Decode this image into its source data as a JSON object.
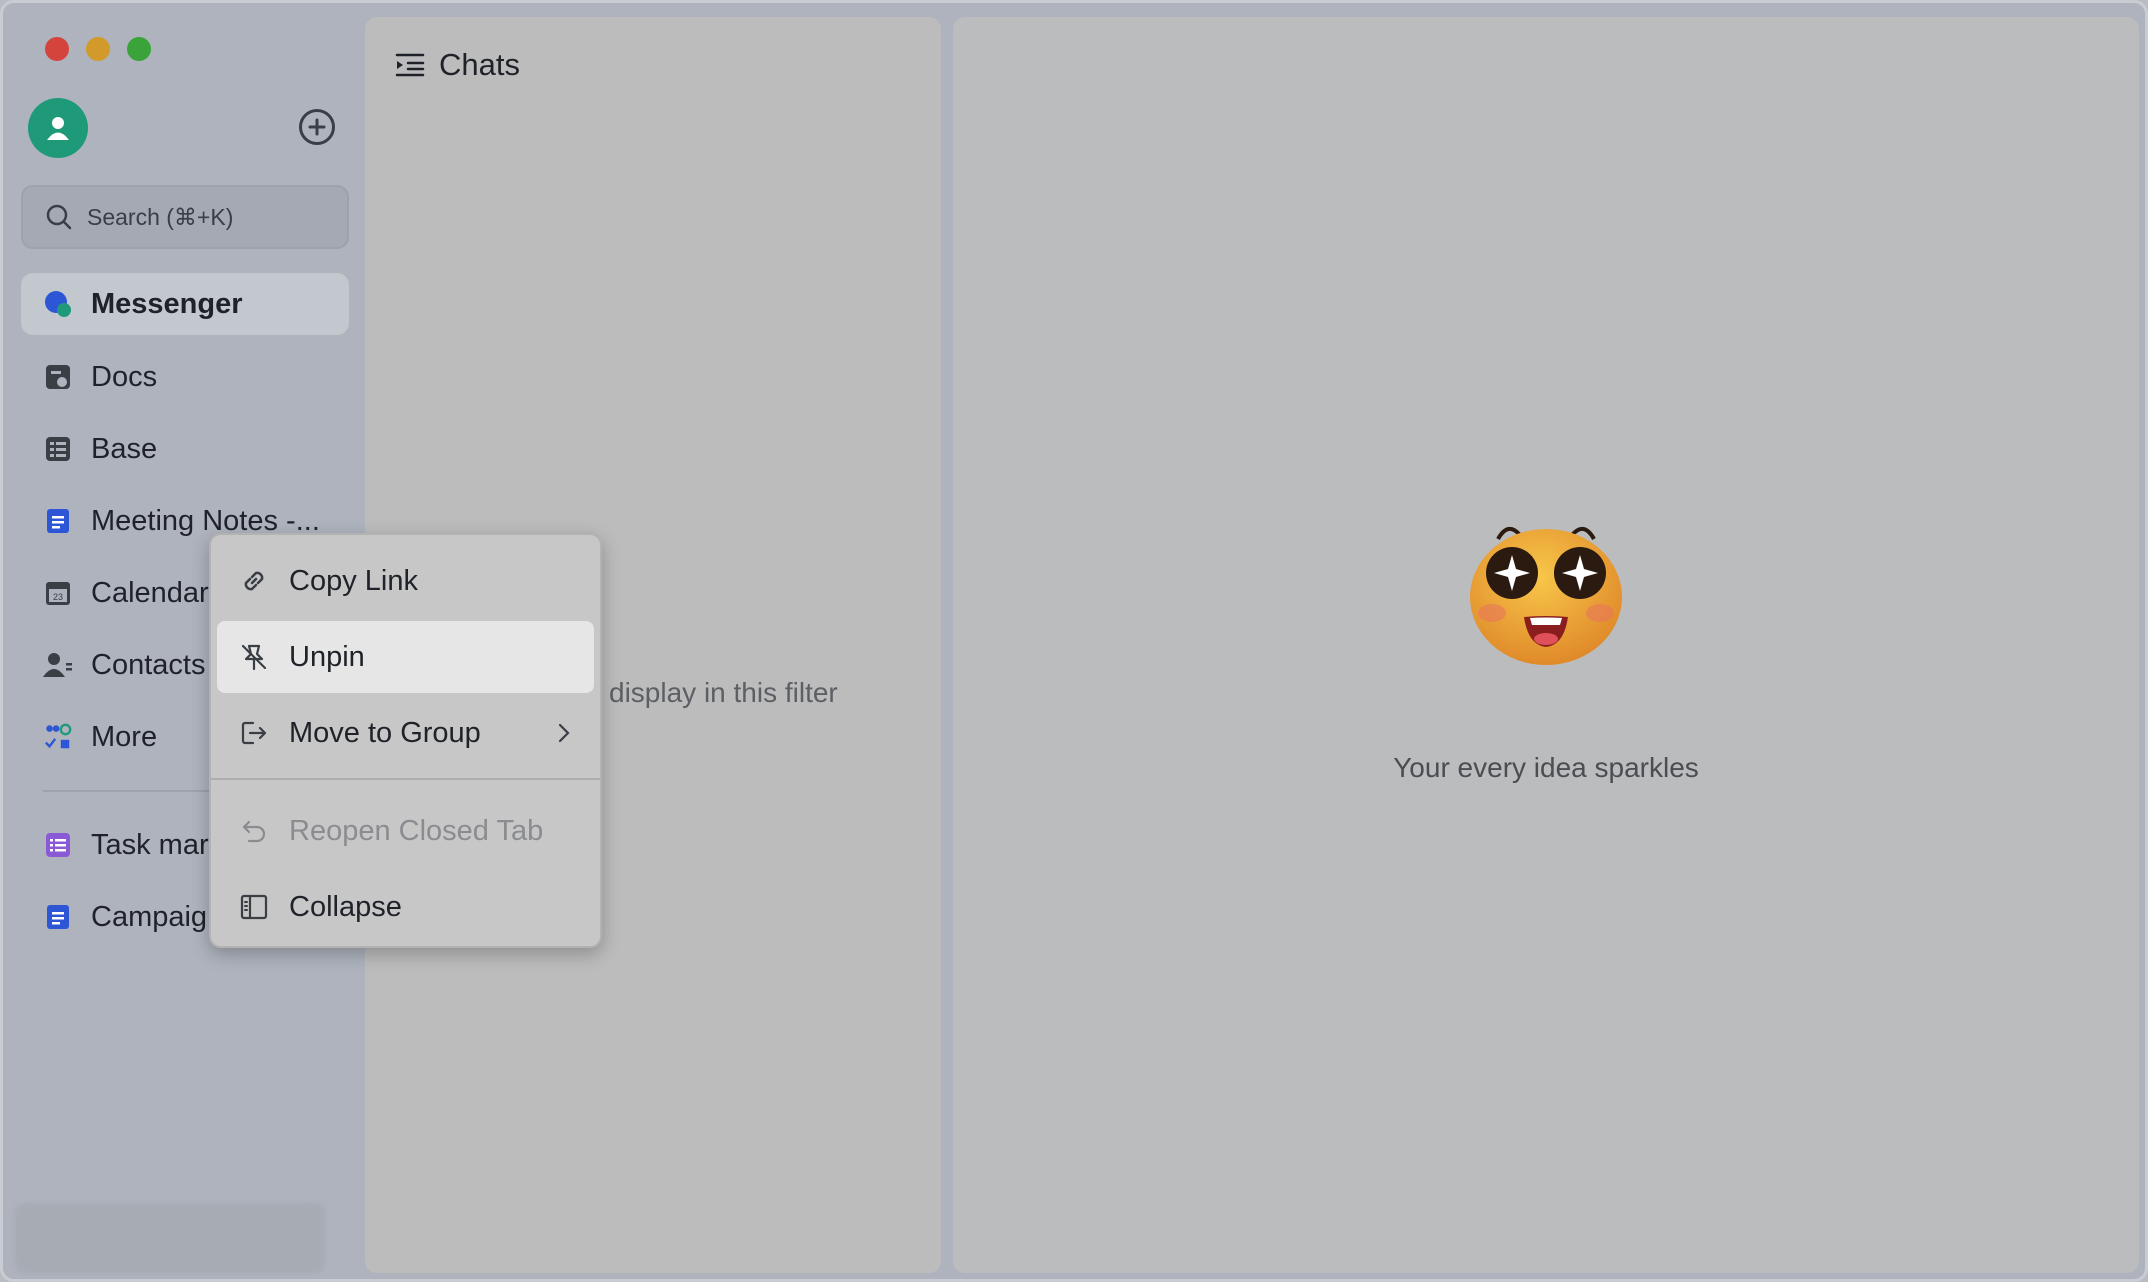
{
  "sidebar": {
    "search_placeholder": "Search (⌘+K)",
    "items": [
      {
        "label": "Messenger",
        "icon": "messenger-icon",
        "active": true
      },
      {
        "label": "Docs",
        "icon": "docs-icon"
      },
      {
        "label": "Base",
        "icon": "base-icon"
      },
      {
        "label": "Meeting Notes -...",
        "icon": "doc-blue-icon"
      },
      {
        "label": "Calendar",
        "icon": "calendar-icon"
      },
      {
        "label": "Contacts",
        "icon": "contacts-icon"
      },
      {
        "label": "More",
        "icon": "apps-icon"
      }
    ],
    "pinned": [
      {
        "label": "Task mar",
        "icon": "task-icon"
      },
      {
        "label": "Campaig",
        "icon": "doc-blue-icon"
      }
    ]
  },
  "chats": {
    "title": "Chats",
    "empty_text": "display in this filter"
  },
  "main": {
    "tagline": "Your every idea sparkles"
  },
  "context_menu": {
    "items": [
      {
        "label": "Copy Link",
        "icon": "link-icon"
      },
      {
        "label": "Unpin",
        "icon": "unpin-icon",
        "highlighted": true
      },
      {
        "label": "Move to Group",
        "icon": "move-icon",
        "submenu": true
      },
      {
        "label": "Reopen Closed Tab",
        "icon": "undo-icon",
        "disabled": true
      },
      {
        "label": "Collapse",
        "icon": "collapse-icon"
      }
    ]
  },
  "colors": {
    "accent_green": "#1f9a79",
    "messenger_blue": "#2d56d6",
    "task_purple": "#8a5ad6"
  }
}
